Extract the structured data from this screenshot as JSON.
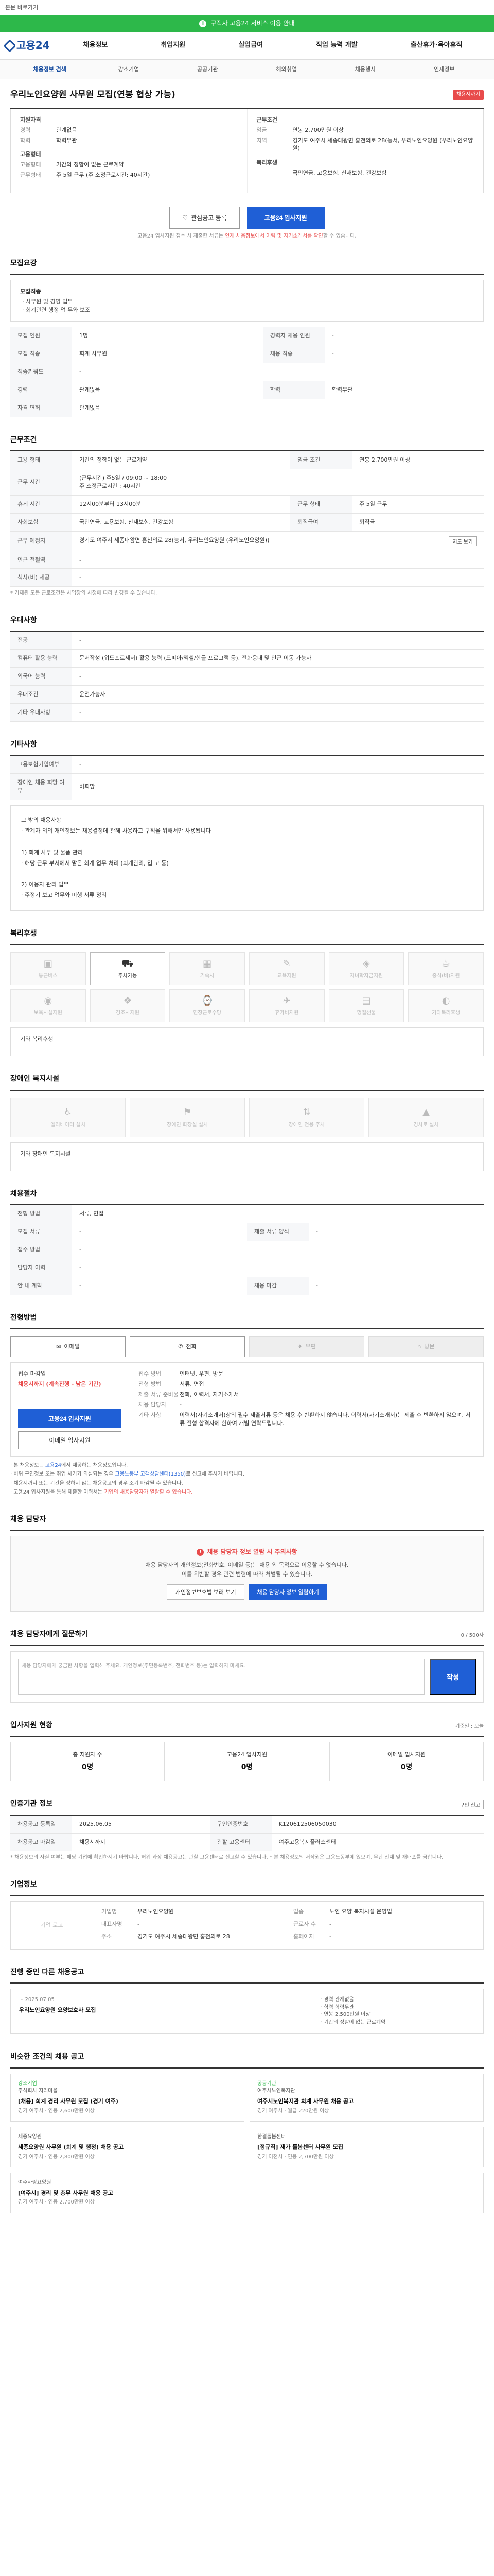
{
  "top": {
    "skip_text": "본문 바로가기",
    "banner_text": "구직자 고용24 서비스 이용 안내",
    "banner_badge": "i",
    "logo": "고용24",
    "menu": [
      "채용정보",
      "취업지원",
      "실업급여",
      "직업 능력 개발",
      "출산휴가·육아휴직"
    ],
    "subtabs": [
      "채용정보 검색",
      "강소기업",
      "공공기관",
      "해외취업",
      "채용행사",
      "인재정보"
    ]
  },
  "job": {
    "title": "우리노인요양원 사무원 모집(연봉 협상 가능)",
    "status_badge": "채용시까지",
    "left": {
      "group1_title": "지원자격",
      "rows1": [
        {
          "k": "경력",
          "v": "관계없음"
        },
        {
          "k": "학력",
          "v": "학력무관"
        }
      ],
      "group2_title": "고용형태",
      "rows2": [
        {
          "k": "고용형태",
          "v": "기간의 정함이 없는 근로계약"
        },
        {
          "k": "근무형태",
          "v": "주 5일 근무 (주 소정근로시간: 40시간)"
        }
      ]
    },
    "right": {
      "group1_title": "근무조건",
      "rows1": [
        {
          "k": "임금",
          "v": "연봉 2,700만원 이상"
        },
        {
          "k": "지역",
          "v": "경기도 여주시 세종대왕면 홍천의로 28(능서, 우리노인요양원 (우리노인요양원)"
        }
      ],
      "group2_title": "복리후생",
      "rows2": [
        {
          "k": "",
          "v": "국민연금, 고용보험, 산재보험, 건강보험"
        }
      ]
    },
    "btn_like": "관심공고 등록",
    "btn_apply": "고용24 입사지원",
    "note": "고용24 입사지원 접수 시 제출한 서류는 ",
    "note_red": "인재 채용정보에서 이력 및 자기소개서를 확인",
    "note_tail": "할 수 있습니다."
  },
  "recruit": {
    "title": "모집요강",
    "job_title": "모집직종",
    "job_lines": [
      "· 사무원 및 경영 업무",
      "· 회계관련 행정 업 무와 보조"
    ],
    "rows": [
      {
        "k": "모집 인원",
        "v": "1명",
        "k2": "경력자 채용 인원",
        "v2": "-"
      },
      {
        "k": "모집 직종",
        "v": "회계 사무원",
        "k2": "채용 직종",
        "v2": "-"
      },
      {
        "k": "직종키워드",
        "v": "-",
        "k2": "",
        "v2": ""
      },
      {
        "k": "경력",
        "v": "관계없음",
        "k2": "학력",
        "v2": "학력무관"
      },
      {
        "k": "자격 면허",
        "v": "관계없음",
        "k2": "",
        "v2": ""
      }
    ]
  },
  "conditions": {
    "title": "근무조건",
    "rows": [
      {
        "k": "고용 형태",
        "v": "기간의 정함이 없는 근로계약",
        "k2": "임금 조건",
        "v2": "연봉 2,700만원 이상"
      },
      {
        "k": "근무 시간",
        "v": "(근무시간) 주5일 / 09:00 ~ 18:00",
        "k2": "",
        "v2": ""
      },
      {
        "k": "휴게 시간",
        "v": "12시00분부터 13시00분",
        "k2": "근무 형태",
        "v2": "주 5일 근무"
      },
      {
        "k": "사회보험",
        "v": "국민연금, 고용보험, 산재보험, 건강보험",
        "k2": "퇴직급여",
        "v2": "퇴직금"
      },
      {
        "k": "근무 예정지",
        "v": "경기도 여주시 세종대왕면 홍천의로 28(능서, 우리노인요양원 (우리노인요양원))",
        "k2": "",
        "v2": ""
      },
      {
        "k": "인근 전철역",
        "v": "-",
        "k2": "",
        "v2": ""
      },
      {
        "k": "식사(비) 제공",
        "v": "-",
        "k2": "",
        "v2": ""
      }
    ],
    "map_btn": "지도 보기",
    "work_hours": "주 소정근로시간 : 40시간",
    "note": "* 기재된 모든 근로조건은 사업장의 사정에 따라 변경될 수 있습니다."
  },
  "preference": {
    "title": "우대사항",
    "rows": [
      {
        "k": "전공",
        "v": "-"
      },
      {
        "k": "컴퓨터 활용 능력",
        "v": "문서작성 (워드프로세서) 활용 능력 (드피아/엑셀/한글 프로그램 등), 전화응대 및 인근 이동 가능자"
      },
      {
        "k": "외국어 능력",
        "v": "-"
      },
      {
        "k": "우대조건",
        "v": "운전가능자"
      },
      {
        "k": "기타 우대사항",
        "v": "-"
      }
    ]
  },
  "detail": {
    "title": "기타사항",
    "rows": [
      {
        "k": "고용보험가입여부",
        "v": "-"
      },
      {
        "k": "장애인 채용 희망 여부",
        "v": "비희망"
      }
    ],
    "body_lines": [
      "그 밖의 채용사항",
      "· 관계자 외의 개인정보는 채용결정에 관해 사용하고 구직을 위해서만 사용됩니다",
      "",
      "1) 회계 사무 및 물품 관리",
      "· 해당 근무 부서에서 맡은 회계 업무 처리 (회계관리, 입 고 등)",
      "",
      "2) 이용자 관리 업무",
      "· 주정기 보고 업무와 미행 서류 정리"
    ]
  },
  "welfare": {
    "title": "복리후생",
    "items": [
      {
        "icon": "▣",
        "label": "통근버스",
        "on": false
      },
      {
        "icon": "⛟",
        "label": "주차가능",
        "on": true
      },
      {
        "icon": "▦",
        "label": "기숙사",
        "on": false
      },
      {
        "icon": "✎",
        "label": "교육지원",
        "on": false
      },
      {
        "icon": "◈",
        "label": "자녀학자금지원",
        "on": false
      },
      {
        "icon": "☕",
        "label": "중식(비)지원",
        "on": false
      },
      {
        "icon": "◉",
        "label": "보육시설지원",
        "on": false
      },
      {
        "icon": "❖",
        "label": "경조사지원",
        "on": false
      },
      {
        "icon": "⌚",
        "label": "연장근로수당",
        "on": false
      },
      {
        "icon": "✈",
        "label": "휴가비지원",
        "on": false
      },
      {
        "icon": "▤",
        "label": "명절선물",
        "on": false
      },
      {
        "icon": "◐",
        "label": "기타복리후생",
        "on": false
      }
    ],
    "etc_label": "기타 복리후생"
  },
  "disability": {
    "title": "장애인 복지시설",
    "items": [
      {
        "icon": "♿",
        "label": "엘리베이터 설치"
      },
      {
        "icon": "⚑",
        "label": "장애인 화장실 설치"
      },
      {
        "icon": "⇅",
        "label": "장애인 전용 주차"
      },
      {
        "icon": "▲",
        "label": "경사로 설치"
      }
    ],
    "etc_label": "기타 장애인 복지시설"
  },
  "process": {
    "title": "채용절차",
    "rows": [
      {
        "k": "전형 방법",
        "v": "서류, 면접",
        "k2": "",
        "v2": ""
      },
      {
        "k": "모집 서류",
        "v": "-",
        "k2": "제출 서류 양식",
        "v2": "-"
      },
      {
        "k": "접수 방법",
        "v": "-",
        "k2": "",
        "v2": ""
      },
      {
        "k": "담당자 이력",
        "v": "-",
        "k2": "",
        "v2": ""
      },
      {
        "k": "안 내 계획",
        "v": "-",
        "k2": "채용 마감",
        "v2": "-"
      }
    ]
  },
  "apply": {
    "title": "전형방법",
    "methods": [
      {
        "icon": "✉",
        "label": "이메일",
        "on": true
      },
      {
        "icon": "✆",
        "label": "전화",
        "on": true
      },
      {
        "icon": "✈",
        "label": "우편",
        "on": false
      },
      {
        "icon": "⌂",
        "label": "방문",
        "on": false
      }
    ],
    "left_label": "접수 마감일",
    "left_red": "채용시까지 (계속진행 - 남은 기간)",
    "left_btn": "고용24 입사지원",
    "left_btn2": "이메일 입사지원",
    "rows": [
      {
        "k": "접수 방법",
        "v": "인터넷, 우편, 방문"
      },
      {
        "k": "전형 방법",
        "v": "서류, 면접"
      },
      {
        "k": "제출 서류 준비물",
        "v": "전화, 이력서, 자기소개서"
      },
      {
        "k": "채용 담당자",
        "v": "-"
      },
      {
        "k": "기타 사항",
        "v": "이력서(자기소개서)상의 필수 제출서류 등은 채용 후 반환하지 않습니다. 이력서(자기소개서)는 제출 후 반환하지 않으며, 서류 전형 합격자에 한하여 개별 연락드립니다."
      }
    ],
    "notes": [
      {
        "text": "· 본 채용정보는 ",
        "b": "고용24",
        "tail": "에서 제공하는 채용정보입니다."
      },
      {
        "text": "· 허위 구인정보 또는 취업 사기가 의심되는 경우 ",
        "b": "고용노동부 고객상담센터(1350)",
        "tail": "로 신고해 주시기 바랍니다."
      },
      {
        "text": "· 채용시까지 또는 기간을 정하지 않는 채용공고의 경우 조기 마감될 수 있습니다.",
        "b": "",
        "tail": ""
      },
      {
        "text": "· 고용24 입사지원을 통해 제출한 이력서는 ",
        "b": "",
        "tail": "",
        "em": "기업의 채용담당자가 열람할 수 있습니다."
      }
    ]
  },
  "reference": {
    "title": "채용 담당자",
    "warn": "채용 담당자 정보 열람 시 주의사항",
    "desc1": "채용 담당자의 개인정보(전화번호, 이메일 등)는 채용 외 목적으로 이용할 수 없습니다.",
    "desc2": "이를 위반할 경우 관련 법령에 따라 처벌될 수 있습니다.",
    "btn1": "개인정보보호법 보러 보기",
    "btn2": "채용 담당자 정보 열람하기"
  },
  "inquiry": {
    "title": "채용 담당자에게 질문하기",
    "counter": "0 / 500자",
    "placeholder": "채용 담당자에게 궁금한 사항을 입력해 주세요. 개인정보(주민등록번호, 전화번호 등)는 입력하지 마세요.",
    "btn": "작성"
  },
  "status": {
    "title": "입사지원 현황",
    "unit": "기준일 : 오늘",
    "items": [
      {
        "label": "총 지원자 수",
        "value": "0명"
      },
      {
        "label": "고용24 입사지원",
        "value": "0명"
      },
      {
        "label": "이메일 입사지원",
        "value": "0명"
      }
    ]
  },
  "offer": {
    "title": "인증기관 정보",
    "rows": [
      {
        "k": "채용공고 등록일",
        "v": "2025.06.05",
        "k2": "구인인증번호",
        "v2": "K120612506050030"
      },
      {
        "k": "채용공고 마감일",
        "v": "채용시까지",
        "k2": "관할 고용센터",
        "v2": "여주고용복지플러스센터"
      }
    ],
    "mini_btn": "구인 신고",
    "notes": "* 채용정보의 사실 여부는 해당 기업에 확인하시기 바랍니다. 허위 과장 채용공고는 관할 고용센터로 신고할 수 있습니다. * 본 채용정보의 저작권은 고용노동부에 있으며, 무단 전재 및 재배포를 금합니다."
  },
  "company": {
    "title": "기업정보",
    "logo_placeholder": "기업 로고",
    "rows": [
      {
        "k": "기업명",
        "v": "우리노인요양원"
      },
      {
        "k": "업종",
        "v": "노인 요양 복지시설 운영업"
      },
      {
        "k": "대표자명",
        "v": "-"
      },
      {
        "k": "근로자 수",
        "v": "-"
      },
      {
        "k": "주소",
        "v": "경기도 여주시 세종대왕면 홍천의로 28"
      },
      {
        "k": "홈페이지",
        "v": "-"
      }
    ]
  },
  "other": {
    "title": "진행 중인 다른 채용공고",
    "date": "~ 2025.07.05",
    "job": "우리노인요양원 요양보호사 모집",
    "meta": [
      "경력 관계없음",
      "학력 학력무관",
      "연봉 2,500만원 이상",
      "기간의 정함이 없는 근로계약"
    ]
  },
  "similar": {
    "title": "비슷한 조건의 채용 공고",
    "cards": [
      {
        "co": "주식회사 지리마을",
        "title": "[채용] 회계 경리 사무원 모집 (경기 여주)",
        "desc": "경기 여주시 · 연봉 2,600만원 이상",
        "tag": "강소기업"
      },
      {
        "co": "여주시노인복지관",
        "title": "여주시노인복지관 회계 사무원 채용 공고",
        "desc": "경기 여주시 · 월급 220만원 이상",
        "tag": "공공기관"
      },
      {
        "co": "세종요양원",
        "title": "세종요양원 사무원 (회계 및 행정) 채용 공고",
        "desc": "경기 여주시 · 연봉 2,800만원 이상",
        "tag": ""
      },
      {
        "co": "한결돌봄센터",
        "title": "[정규직] 재가 돌봄센터 사무원 모집",
        "desc": "경기 이천시 · 연봉 2,700만원 이상",
        "tag": ""
      },
      {
        "co": "여주사랑요양원",
        "title": "[여주시] 경리 및 총무 사무원 채용 공고",
        "desc": "경기 여주시 · 연봉 2,700만원 이상",
        "tag": ""
      },
      {
        "co": "",
        "title": "",
        "desc": "",
        "tag": ""
      }
    ]
  }
}
